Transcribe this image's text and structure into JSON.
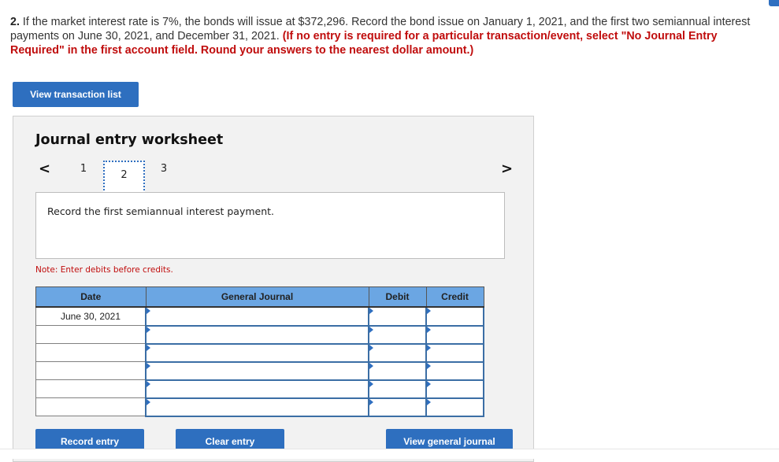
{
  "question": {
    "number": "2.",
    "text": " If the market interest rate is 7%, the bonds will issue at $372,296. Record the bond issue on January 1, 2021, and the first two semiannual interest payments on June 30, 2021, and December 31, 2021. ",
    "instruction": "(If no entry is required for a particular transaction/event, select \"No Journal Entry Required\" in the first account field. Round your answers to the nearest dollar amount.)"
  },
  "buttons": {
    "view_transaction_list": "View transaction list",
    "record_entry": "Record entry",
    "clear_entry": "Clear entry",
    "view_general_journal": "View general journal"
  },
  "worksheet": {
    "title": "Journal entry worksheet",
    "prev_icon": "‹",
    "next_icon": "›",
    "steps": [
      "1",
      "2",
      "3"
    ],
    "active_step": "2",
    "description": "Record the first semiannual interest payment.",
    "note": "Note: Enter debits before credits."
  },
  "journal": {
    "headers": {
      "date": "Date",
      "general_journal": "General Journal",
      "debit": "Debit",
      "credit": "Credit"
    },
    "rows": [
      {
        "date": "June 30, 2021",
        "account": "",
        "debit": "",
        "credit": ""
      },
      {
        "date": "",
        "account": "",
        "debit": "",
        "credit": ""
      },
      {
        "date": "",
        "account": "",
        "debit": "",
        "credit": ""
      },
      {
        "date": "",
        "account": "",
        "debit": "",
        "credit": ""
      },
      {
        "date": "",
        "account": "",
        "debit": "",
        "credit": ""
      },
      {
        "date": "",
        "account": "",
        "debit": "",
        "credit": ""
      }
    ]
  },
  "colors": {
    "primary_button": "#2e6fbf",
    "header_fill": "#6ba6e3",
    "instruction_red": "#c00d0d",
    "panel_bg": "#f2f2f2"
  }
}
